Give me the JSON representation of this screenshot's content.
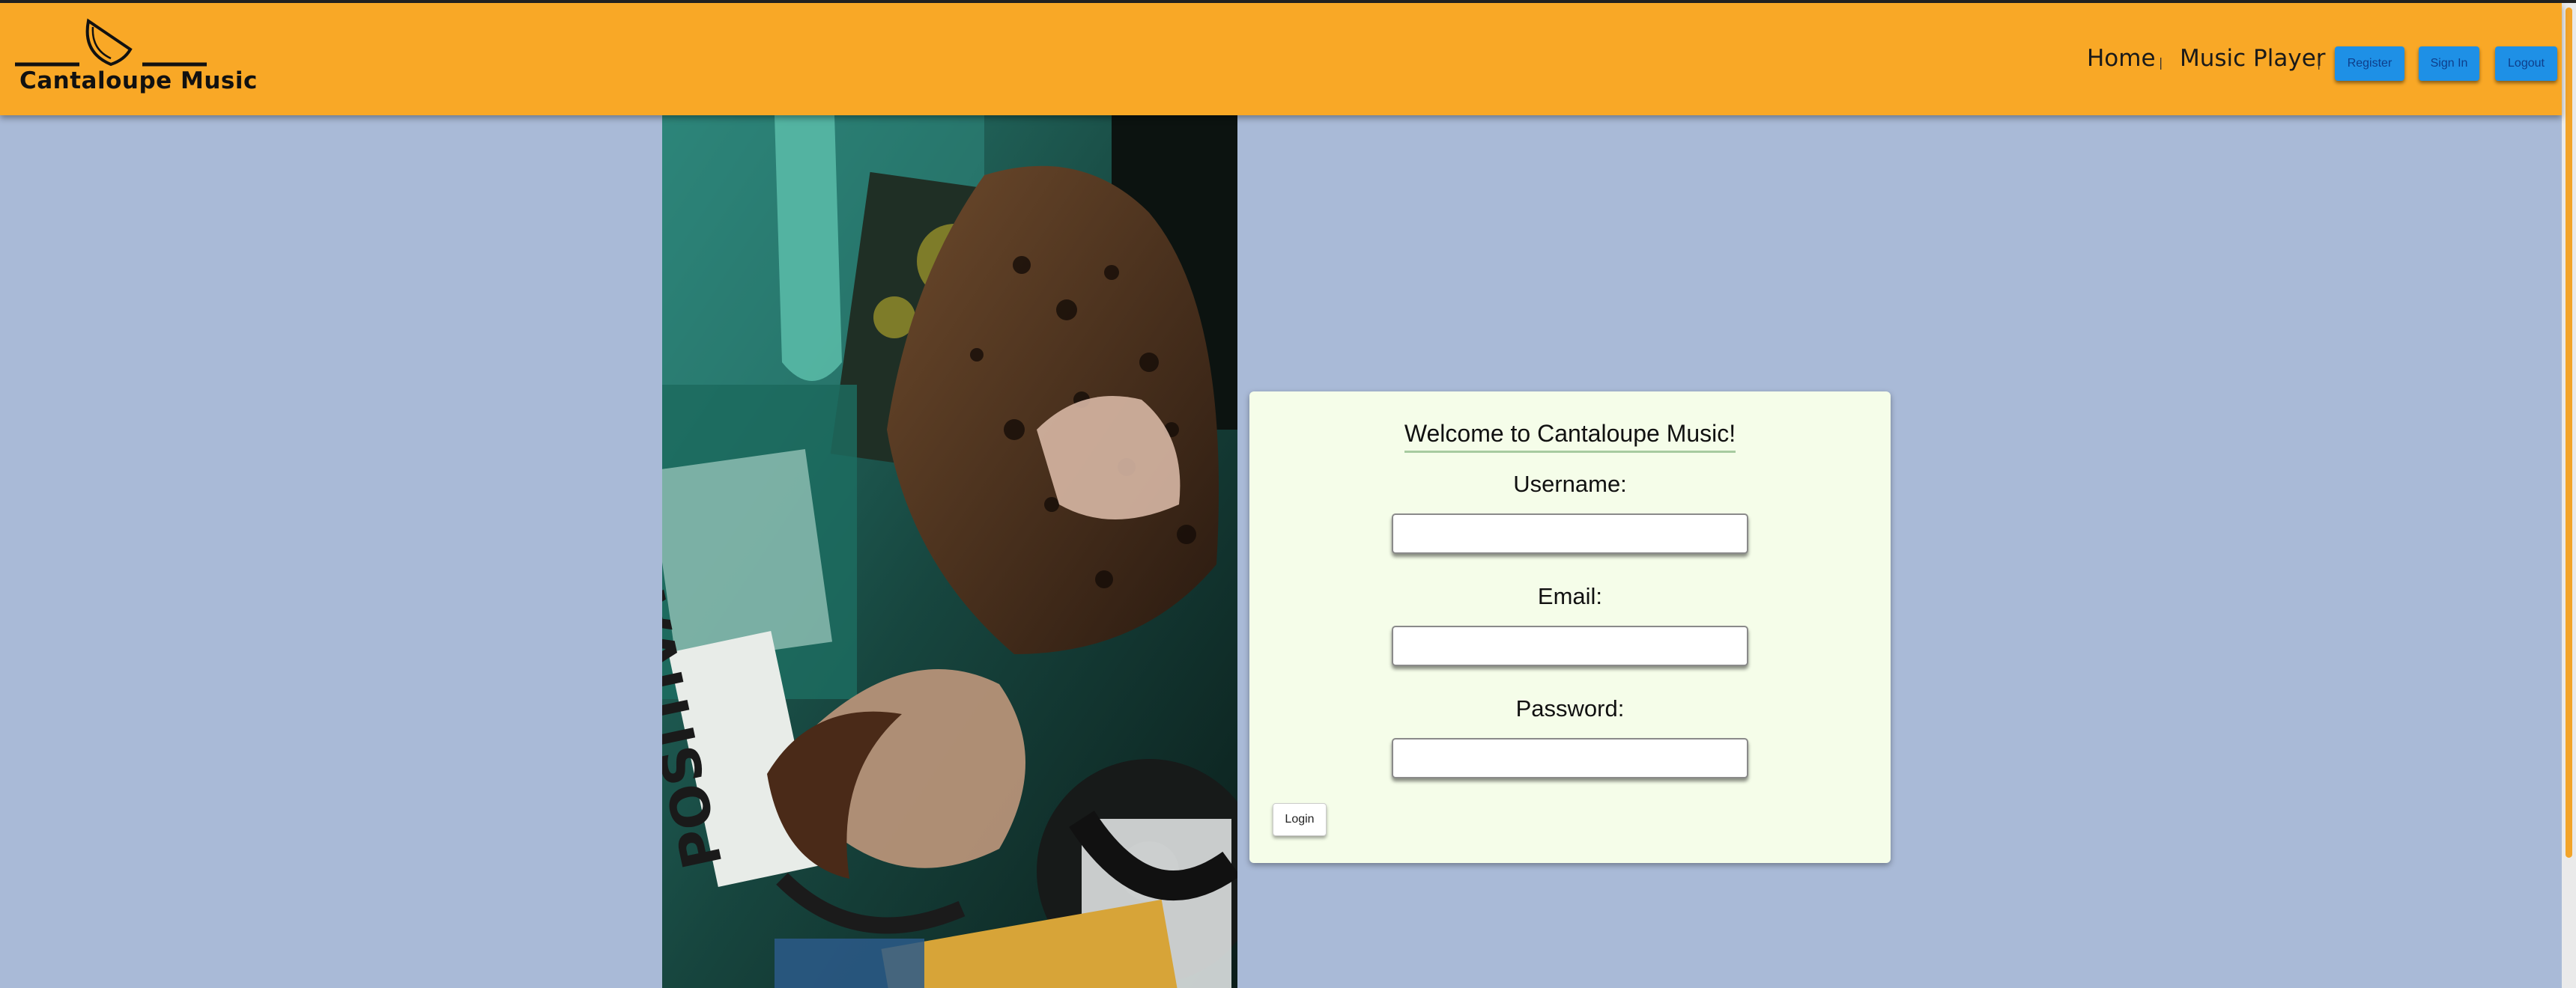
{
  "brand": {
    "name": "Cantaloupe Music",
    "logo_icon": "cantaloupe-slice-icon",
    "color": "#f9a826"
  },
  "nav": {
    "links": [
      "Home",
      "Music Player"
    ],
    "separator": "|",
    "buttons": [
      "Register",
      "Sign In",
      "Logout"
    ],
    "button_color": "#1e90e6"
  },
  "hero_image": {
    "subject": "photo"
  },
  "login_card": {
    "title": "Welcome to Cantaloupe Music!",
    "username_label": "Username:",
    "email_label": "Email:",
    "password_label": "Password:",
    "username_value": "",
    "email_value": "",
    "password_value": "",
    "submit_label": "Login",
    "background": "#f5fde9"
  },
  "page": {
    "background": "#a9bad7"
  }
}
